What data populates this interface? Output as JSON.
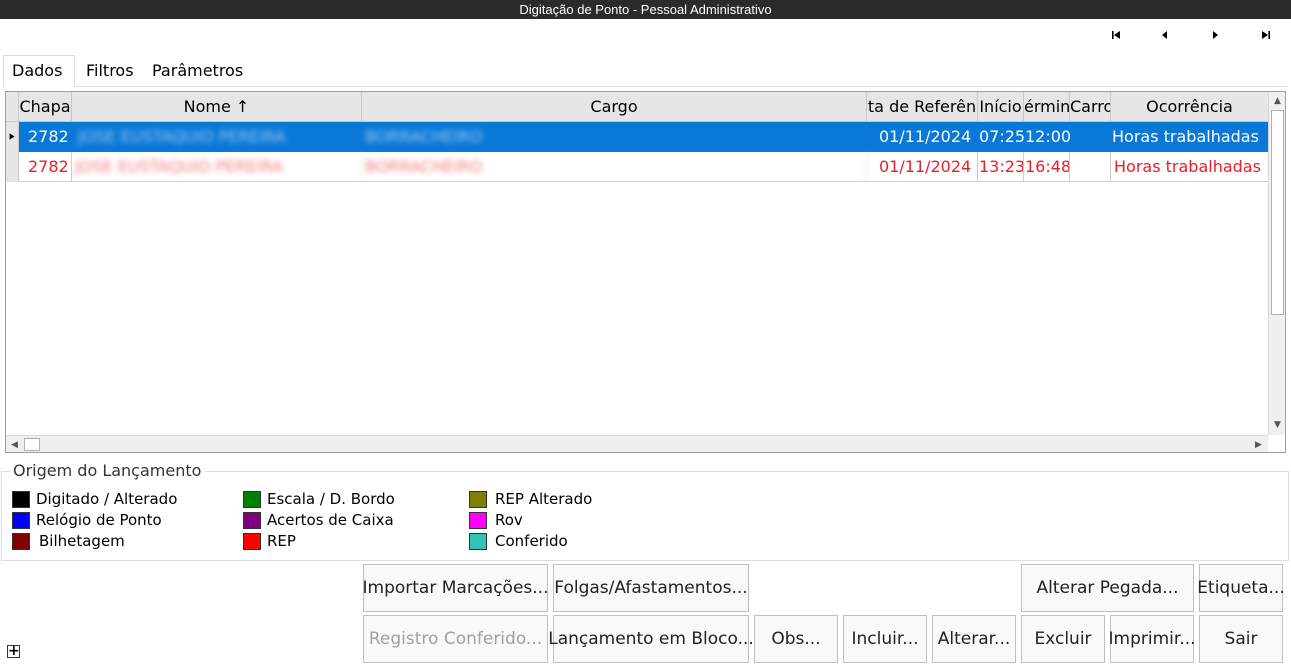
{
  "window": {
    "title": "Digitação de Ponto - Pessoal Administrativo"
  },
  "nav": {
    "first": "first-record",
    "prev": "previous-record",
    "next": "next-record",
    "last": "last-record"
  },
  "tabs": [
    {
      "label": "Dados"
    },
    {
      "label": "Filtros"
    },
    {
      "label": "Parâmetros"
    }
  ],
  "grid": {
    "columns": [
      {
        "label": "Chapa"
      },
      {
        "label": "Nome ↑"
      },
      {
        "label": "Cargo"
      },
      {
        "label": "ta de Referên"
      },
      {
        "label": "Início"
      },
      {
        "label": "érmin"
      },
      {
        "label": "Carro"
      },
      {
        "label": "Ocorrência"
      }
    ],
    "rows": [
      {
        "chapa": "2782",
        "nome": "JOSE EUSTAQUIO PEREIRA",
        "cargo": "BORRACHEIRO",
        "data": "01/11/2024",
        "inicio": "07:25",
        "termino": "12:00",
        "carro": "",
        "ocorrencia": "Horas trabalhadas"
      },
      {
        "chapa": "2782",
        "nome": "JOSE EUSTAQUIO PEREIRA",
        "cargo": "BORRACHEIRO",
        "data": "01/11/2024",
        "inicio": "13:23",
        "termino": "16:48",
        "carro": "",
        "ocorrencia": "Horas trabalhadas"
      }
    ]
  },
  "legend": {
    "title": "Origem do Lançamento",
    "items": [
      {
        "label": "Digitado / Alterado",
        "color": "#000000"
      },
      {
        "label": "Relógio de Ponto",
        "color": "#0000ff"
      },
      {
        "label": "Bilhetagem",
        "color": "#800000"
      },
      {
        "label": "Escala / D. Bordo",
        "color": "#008000"
      },
      {
        "label": "Acertos de Caixa",
        "color": "#800080"
      },
      {
        "label": "REP",
        "color": "#ff0000"
      },
      {
        "label": "REP Alterado",
        "color": "#808000"
      },
      {
        "label": "Rov",
        "color": "#ff00ff"
      },
      {
        "label": "Conferido",
        "color": "#2ec4b6"
      }
    ]
  },
  "buttons": {
    "importar": "Importar Marcações...",
    "folgas": "Folgas/Afastamentos...",
    "alterar_pegada": "Alterar Pegada...",
    "etiqueta": "Etiqueta...",
    "registro": "Registro Conferido...",
    "lancamento": "Lançamento em Bloco...",
    "obs": "Obs...",
    "incluir": "Incluir...",
    "alterar": "Alterar...",
    "excluir": "Excluir",
    "imprimir": "Imprimir...",
    "sair": "Sair"
  },
  "colors": {
    "selection": "#0a78d7",
    "alert_text": "#e8202a"
  }
}
